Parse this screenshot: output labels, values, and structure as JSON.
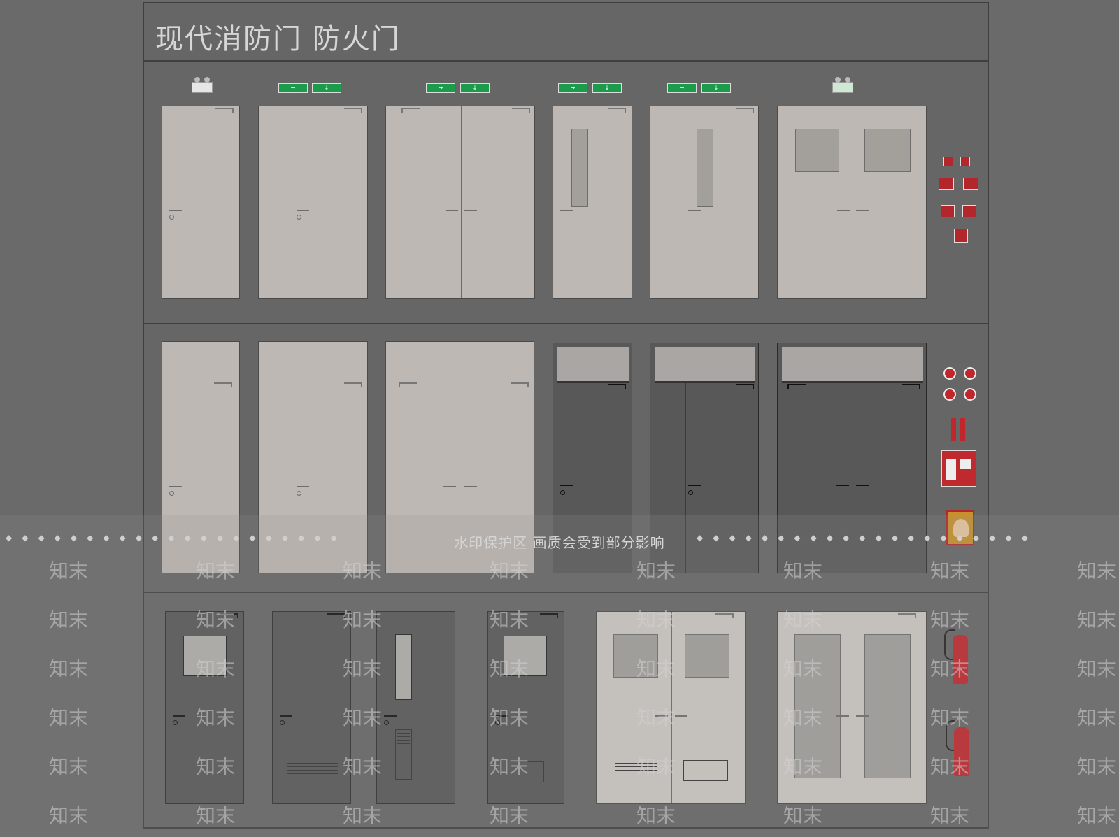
{
  "title": "现代消防门 防火门",
  "watermark": {
    "banner": "水印保护区  画质会受到部分影响",
    "word": "知末"
  },
  "colors": {
    "background": "#6a6a6a",
    "door_light": "#bdb8b3",
    "door_dark": "#585858",
    "door_white": "#cfcbc6",
    "exit_green": "#1c9b4c",
    "fire_red": "#c0262b"
  },
  "icons": [
    "exit-sign-icon",
    "emergency-light-icon",
    "fire-alarm-icon",
    "fire-extinguisher-icon",
    "fire-hydrant-icon",
    "control-panel-icon"
  ]
}
